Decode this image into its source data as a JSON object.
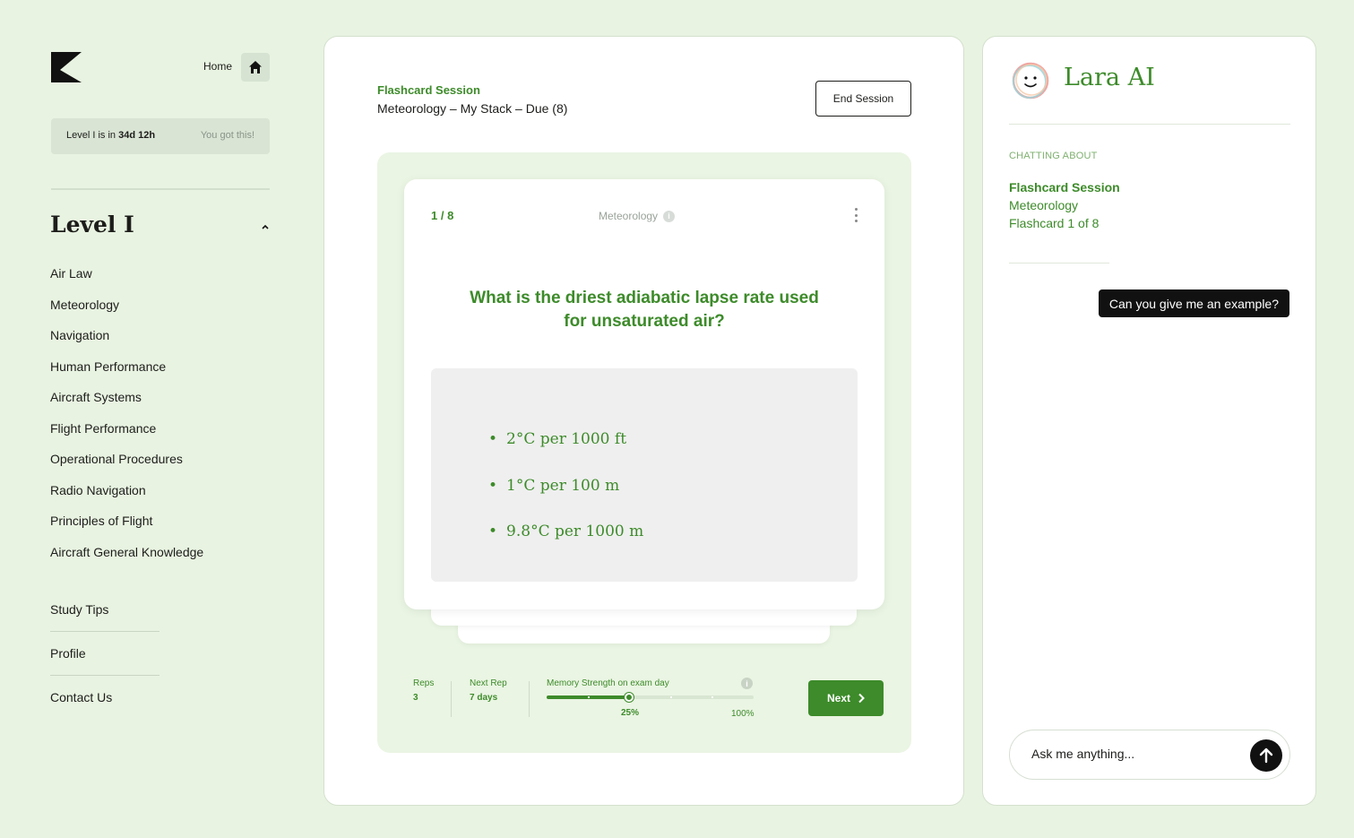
{
  "sidebar": {
    "home_label": "Home",
    "level_box": {
      "prefix": "Level I is in ",
      "countdown": "34d 12h",
      "encouragement": "You got this!"
    },
    "level_heading": "Level I",
    "subjects": [
      "Air Law",
      "Meteorology",
      "Navigation",
      "Human Performance",
      "Aircraft Systems",
      "Flight Performance",
      "Operational Procedures",
      "Radio Navigation",
      "Principles of Flight",
      "Aircraft General Knowledge"
    ],
    "bottom_nav": [
      "Study Tips",
      "Profile",
      "Contact Us"
    ]
  },
  "session": {
    "title": "Flashcard Session",
    "subtitle": "Meteorology – My Stack – Due (8)",
    "end_button": "End Session"
  },
  "flashcard": {
    "counter": "1 / 8",
    "topic": "Meteorology",
    "question": "What is the driest adiabatic lapse rate used for unsaturated air?",
    "answers": [
      "2°C per 1000 ft",
      "1°C per 100 m",
      "9.8°C per 1000 m"
    ]
  },
  "stats": {
    "reps_label": "Reps",
    "reps_value": "3",
    "next_rep_label": "Next Rep",
    "next_rep_value": "7 days",
    "memory_label": "Memory Strength on exam day",
    "memory_value_label": "25%",
    "memory_max_label": "100%",
    "memory_fraction": 0.4
  },
  "next_button": "Next",
  "chat": {
    "ai_name": "Lara AI",
    "chatting_about": "CHATTING ABOUT",
    "context_title": "Flashcard Session",
    "context_subject": "Meteorology",
    "context_card": "Flashcard 1 of 8",
    "messages": [
      "Can you give me an example?"
    ],
    "input_placeholder": "Ask me anything..."
  },
  "colors": {
    "accent_green": "#3d8b2a",
    "background": "#e8f3e1",
    "dark": "#111111"
  }
}
